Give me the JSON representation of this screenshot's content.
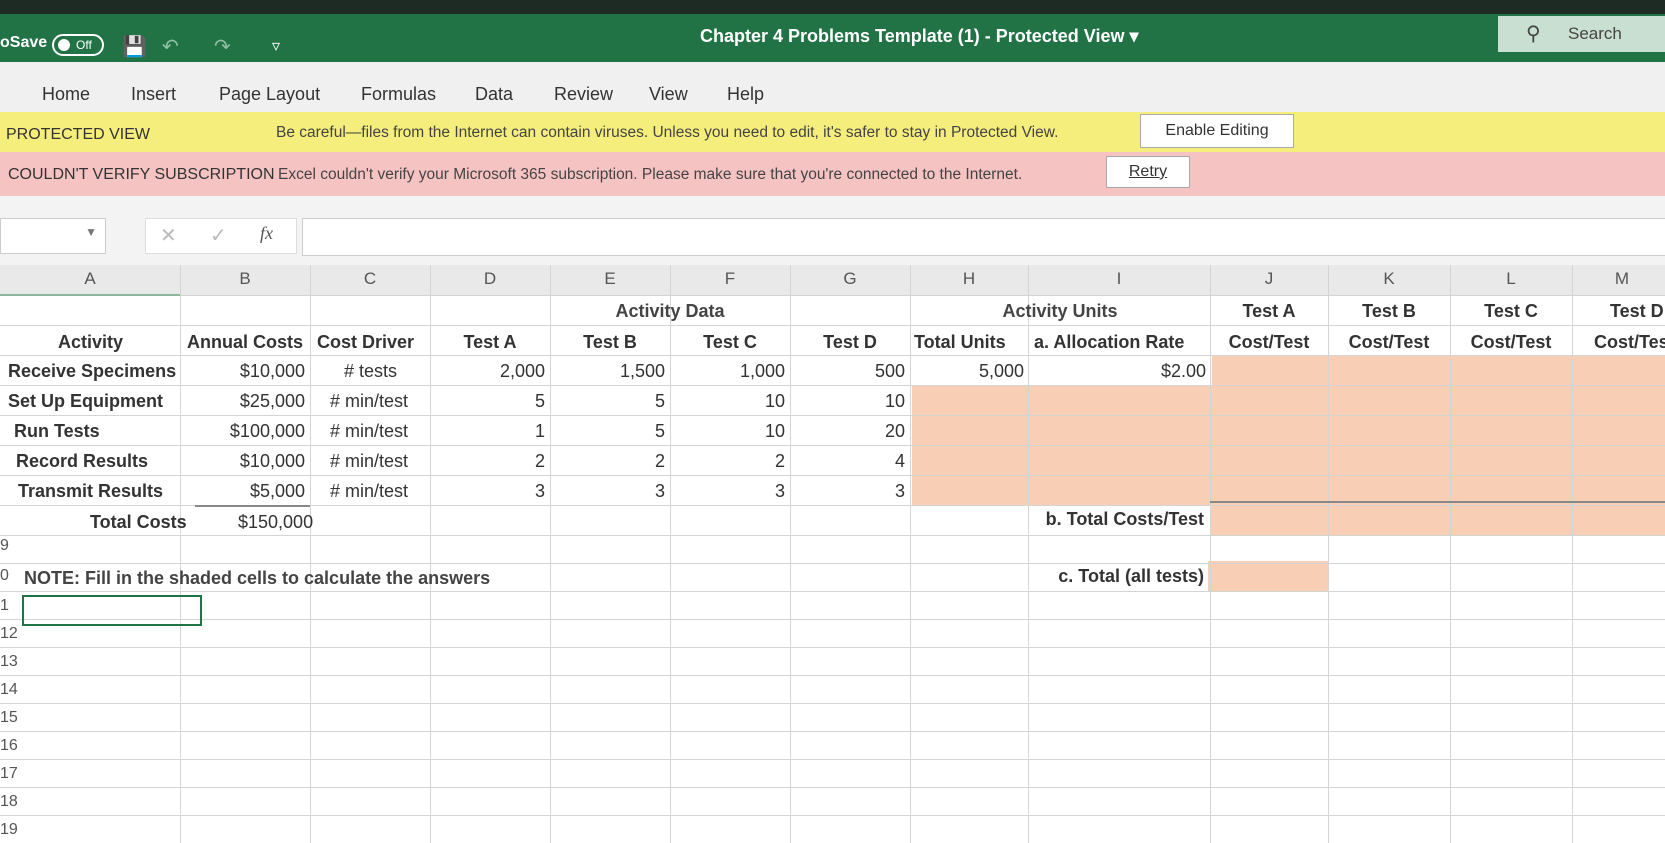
{
  "titlebar": {
    "autosave_label": "oSave",
    "autosave_state": "Off",
    "title": "Chapter 4 Problems Template (1)  -  Protected View",
    "search_label": "Search"
  },
  "ribbon": {
    "tabs": [
      "Home",
      "Insert",
      "Page Layout",
      "Formulas",
      "Data",
      "Review",
      "View",
      "Help"
    ]
  },
  "protected_bar": {
    "label": "PROTECTED VIEW",
    "message": "Be careful—files from the Internet can contain viruses. Unless you need to edit, it's safer to stay in Protected View.",
    "button": "Enable Editing",
    "color": "#f6ee7c"
  },
  "subscription_bar": {
    "label": "COULDN'T VERIFY SUBSCRIPTION",
    "message": "Excel couldn't verify your Microsoft 365 subscription. Please make sure that you're connected to the Internet.",
    "button": "Retry",
    "color": "#f6c3c3"
  },
  "formula_bar": {
    "fx_label": "fx",
    "value": ""
  },
  "sheet": {
    "columns": [
      "A",
      "B",
      "C",
      "D",
      "E",
      "F",
      "G",
      "H",
      "I",
      "J",
      "K",
      "L",
      "M"
    ],
    "group_headers": {
      "activity_data": "Activity Data",
      "activity_units": "Activity Units"
    },
    "headers": {
      "activity": "Activity",
      "annual_costs": "Annual Costs",
      "cost_driver": "Cost Driver",
      "test_a": "Test A",
      "test_b": "Test B",
      "test_c": "Test C",
      "test_d": "Test D",
      "total_units": "Total Units",
      "allocation_rate": "a. Allocation Rate",
      "j_top": "Test A",
      "j_bot": "Cost/Test",
      "k_top": "Test B",
      "k_bot": "Cost/Test",
      "l_top": "Test C",
      "l_bot": "Cost/Test",
      "m_top": "Test D",
      "m_bot": "Cost/Test"
    },
    "rows": [
      {
        "activity": "Receive Specimens",
        "cost": "$10,000",
        "driver": "# tests",
        "a": "2,000",
        "b": "1,500",
        "c": "1,000",
        "d": "500",
        "total": "5,000",
        "rate": "$2.00"
      },
      {
        "activity": "Set Up Equipment",
        "cost": "$25,000",
        "driver": "# min/test",
        "a": "5",
        "b": "5",
        "c": "10",
        "d": "10",
        "total": "",
        "rate": ""
      },
      {
        "activity": "Run Tests",
        "cost": "$100,000",
        "driver": "# min/test",
        "a": "1",
        "b": "5",
        "c": "10",
        "d": "20",
        "total": "",
        "rate": ""
      },
      {
        "activity": "Record Results",
        "cost": "$10,000",
        "driver": "# min/test",
        "a": "2",
        "b": "2",
        "c": "2",
        "d": "4",
        "total": "",
        "rate": ""
      },
      {
        "activity": "Transmit Results",
        "cost": "$5,000",
        "driver": "# min/test",
        "a": "3",
        "b": "3",
        "c": "3",
        "d": "3",
        "total": "",
        "rate": ""
      }
    ],
    "total_costs_label": "Total Costs",
    "total_costs_value": "$150,000",
    "total_per_test_label": "b. Total Costs/Test",
    "total_all_label": "c. Total (all tests)",
    "note": "NOTE: Fill in the shaded cells to calculate the  answers",
    "row_numbers": [
      "9",
      "0",
      "1",
      "12",
      "13",
      "14",
      "15",
      "16",
      "17",
      "18",
      "19"
    ],
    "shade_color": "#f8cfb5"
  }
}
